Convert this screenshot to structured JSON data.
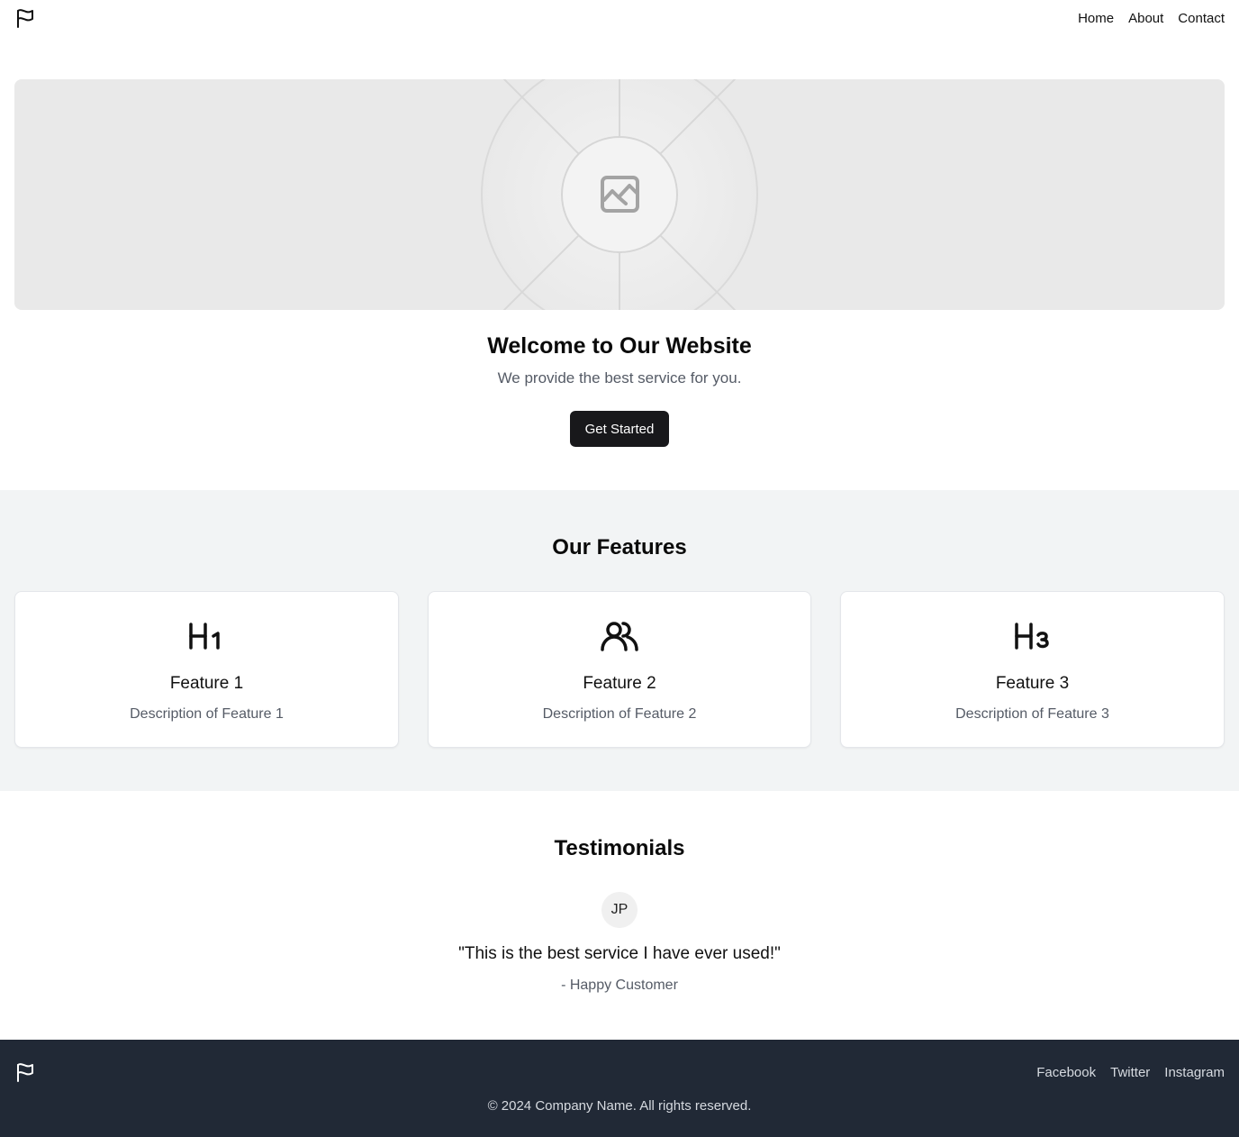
{
  "header": {
    "logo_icon": "flag-icon",
    "nav": [
      {
        "label": "Home"
      },
      {
        "label": "About"
      },
      {
        "label": "Contact"
      }
    ]
  },
  "hero": {
    "image_icon": "image-placeholder-icon",
    "title": "Welcome to Our Website",
    "subtitle": "We provide the best service for you.",
    "cta_label": "Get Started"
  },
  "features": {
    "title": "Our Features",
    "items": [
      {
        "icon": "heading-1-icon",
        "title": "Feature 1",
        "description": "Description of Feature 1"
      },
      {
        "icon": "users-icon",
        "title": "Feature 2",
        "description": "Description of Feature 2"
      },
      {
        "icon": "heading-3-icon",
        "title": "Feature 3",
        "description": "Description of Feature 3"
      }
    ]
  },
  "testimonials": {
    "title": "Testimonials",
    "avatar_initials": "JP",
    "quote": "\"This is the best service I have ever used!\"",
    "author": "- Happy Customer"
  },
  "footer": {
    "logo_icon": "flag-icon",
    "links": [
      {
        "label": "Facebook"
      },
      {
        "label": "Twitter"
      },
      {
        "label": "Instagram"
      }
    ],
    "copyright": "© 2024 Company Name. All rights reserved."
  },
  "colors": {
    "primary_button": "#18181b",
    "features_background": "#f2f4f5",
    "footer_background": "#212936",
    "muted_text": "#555b66"
  }
}
